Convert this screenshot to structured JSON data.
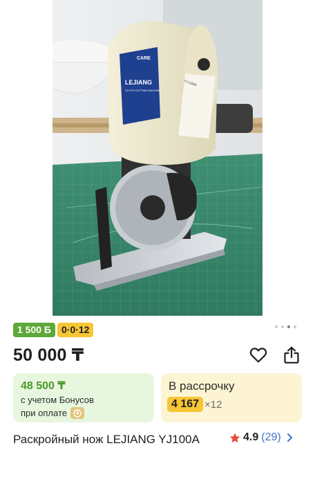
{
  "product": {
    "image_alt": "Раскройный нож LEJIANG YJ100A",
    "machine_label": {
      "brand": "LEJIANG",
      "care": "CARE",
      "type": "CLOTH CUTTING MACHINE",
      "model": "YJ-100A"
    },
    "badges": {
      "bonus": "1 500 Б",
      "installment": "0·0·12"
    },
    "carousel": {
      "count": 4,
      "active_index": 2
    },
    "price": "50 000 ₸",
    "bonus_card": {
      "price": "48 500 ₸",
      "line1": "с учетом Бонусов",
      "line2": "при оплате"
    },
    "installment_card": {
      "title": "В рассрочку",
      "amount": "4 167",
      "months": "×12"
    },
    "title": "Раскройный нож LEJIANG YJ100A",
    "rating": {
      "value": "4.9",
      "count": "(29)"
    }
  },
  "colors": {
    "bonus_green": "#5ea83a",
    "installment_yellow": "#f7c535",
    "rating_star": "#e74c3c",
    "link_blue": "#3d72c8"
  },
  "icons": [
    "heart-icon",
    "share-icon",
    "star-icon",
    "chevron-right-icon",
    "wallet-icon"
  ]
}
